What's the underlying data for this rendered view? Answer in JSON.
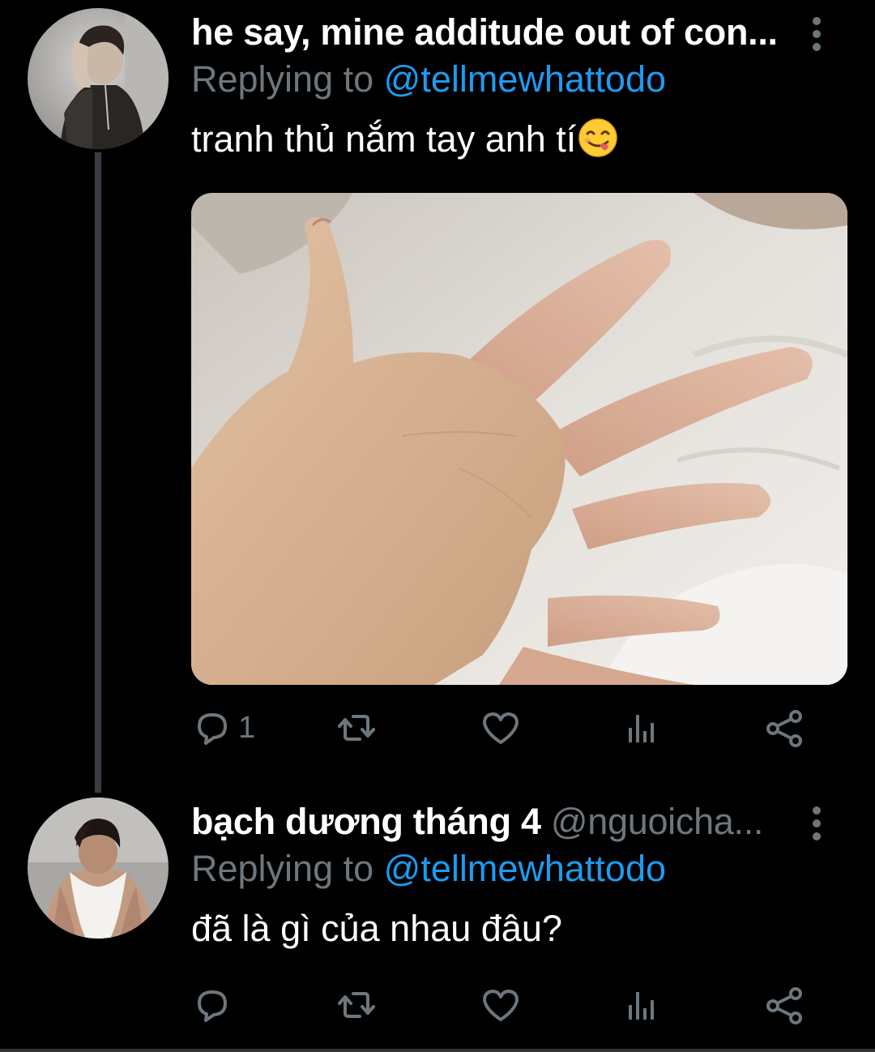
{
  "tweets": [
    {
      "display_name": "he say, mine additude out of con...",
      "handle": "",
      "replying_prefix": "Replying to ",
      "replying_to": "@tellmewhattodo",
      "text": "tranh thủ nắm tay anh tí",
      "emoji": "face-savoring-food-emoji",
      "media": "photo of two interlocked hands on white sheets",
      "reply_count": "1",
      "retweet_count": "",
      "like_count": ""
    },
    {
      "display_name": "bạch dương tháng 4",
      "handle": "@nguoicha...",
      "replying_prefix": "Replying to ",
      "replying_to": "@tellmewhattodo",
      "text": "đã là gì của nhau đâu?",
      "reply_count": "",
      "retweet_count": "",
      "like_count": ""
    }
  ],
  "icons": {
    "reply": "reply-icon",
    "retweet": "retweet-icon",
    "like": "heart-icon",
    "views": "views-icon",
    "share": "share-icon",
    "more": "more-icon"
  },
  "colors": {
    "background": "#000000",
    "text_primary": "#ffffff",
    "text_secondary": "#6e767d",
    "link": "#1d9bf0",
    "thread_line": "#3a3d42"
  }
}
